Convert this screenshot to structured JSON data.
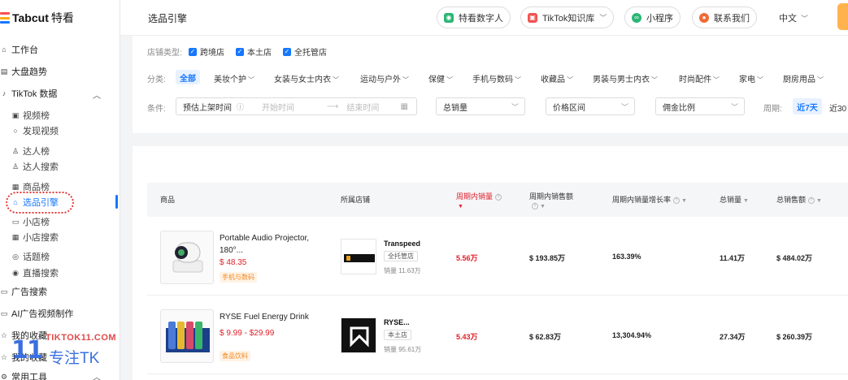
{
  "brand": {
    "name": "Tabcut",
    "cn": "特看"
  },
  "sidebar": {
    "items": [
      {
        "label": "工作台",
        "icon": "home-icon"
      },
      {
        "label": "大盘趋势",
        "icon": "trend-icon"
      },
      {
        "label": "TikTok 数据",
        "icon": "tiktok-icon"
      },
      {
        "label": "视频榜",
        "icon": "video-icon"
      },
      {
        "label": "发现视频",
        "icon": "circle-icon"
      },
      {
        "label": "达人榜",
        "icon": "user-icon"
      },
      {
        "label": "达人搜索",
        "icon": "user-search-icon"
      },
      {
        "label": "商品榜",
        "icon": "product-icon"
      },
      {
        "label": "选品引擎",
        "icon": "bag-icon"
      },
      {
        "label": "小店榜",
        "icon": "shop-icon"
      },
      {
        "label": "小店搜索",
        "icon": "shop-search-icon"
      },
      {
        "label": "话题榜",
        "icon": "topic-icon"
      },
      {
        "label": "直播搜索",
        "icon": "live-icon"
      },
      {
        "label": "广告搜索",
        "icon": "ad-icon"
      },
      {
        "label": "AI广告视频制作",
        "icon": "ai-icon"
      },
      {
        "label": "我的收藏",
        "icon": "star-icon"
      },
      {
        "label": "常用工具",
        "icon": "tool-icon"
      }
    ]
  },
  "header": {
    "title": "选品引擎",
    "btn_digital": "特看数字人",
    "btn_kb": "TikTok知识库",
    "btn_mini": "小程序",
    "btn_contact": "联系我们",
    "lang": "中文"
  },
  "filters": {
    "store_type_label": "店铺类型:",
    "store_types": [
      "跨境店",
      "本土店",
      "全托管店"
    ],
    "category_label": "分类:",
    "categories": [
      "全部",
      "美妆个护",
      "女装与女士内衣",
      "运动与户外",
      "保健",
      "手机与数码",
      "收藏品",
      "男装与男士内衣",
      "时尚配件",
      "家电",
      "厨房用品"
    ],
    "condition_label": "条件:",
    "date_label": "预估上架时间",
    "start_placeholder": "开始时间",
    "end_placeholder": "结束时间",
    "total_sales": "总销量",
    "price_range": "价格区间",
    "commission": "佣金比例",
    "period_label": "周期:",
    "period_active": "近7天",
    "period_next": "近30"
  },
  "table": {
    "headers": {
      "product": "商品",
      "shop": "所属店铺",
      "period_sales": "周期内销量",
      "period_gmv": "周期内销售额",
      "growth": "周期内销量增长率",
      "total_sales": "总销量",
      "total_gmv": "总销售额"
    },
    "rows": [
      {
        "name": "Portable Audio Projector, 180°...",
        "price": "$ 48.35",
        "tag": "手机与数码",
        "shop": "Transpeed",
        "shop_type": "全托管店",
        "shop_sales": "销量 11.63万",
        "period_sales": "5.56万",
        "period_gmv": "$ 193.85万",
        "growth": "163.39%",
        "total_sales": "11.41万",
        "total_gmv": "$ 484.02万"
      },
      {
        "name": "RYSE Fuel Energy Drink",
        "price": "$ 9.99 - $29.99",
        "tag": "食品饮料",
        "shop": "RYSE...",
        "shop_type": "本土店",
        "shop_sales": "销量 95.61万",
        "period_sales": "5.43万",
        "period_gmv": "$ 62.83万",
        "growth": "13,304.94%",
        "total_sales": "27.34万",
        "total_gmv": "$ 260.39万"
      }
    ]
  },
  "watermark": {
    "num": "11",
    "site": "TIKTOK11.COM",
    "cn": "专注TK"
  }
}
